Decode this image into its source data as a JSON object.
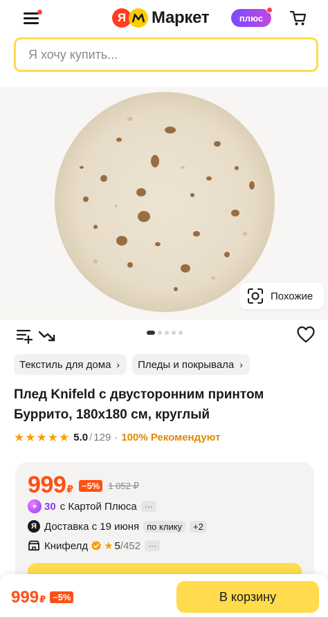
{
  "header": {
    "logo_letter": "Я",
    "logo_text": "Маркет",
    "plus_label": "плюс",
    "icons": [
      "menu-icon",
      "cart-icon"
    ]
  },
  "search": {
    "placeholder": "Я хочу купить..."
  },
  "gallery": {
    "similar_label": "Похожие",
    "total_images": 5,
    "active_index": 0
  },
  "breadcrumbs": [
    {
      "label": "Текстиль для дома"
    },
    {
      "label": "Пледы и покрывала"
    }
  ],
  "product": {
    "title": "Плед Knifeld с двусторонним принтом Буррито, 180х180 см, круглый",
    "rating": "5.0",
    "rating_separator": "/",
    "reviews_count": "129",
    "recommend_text": "100% Рекомендуют",
    "stars": 5
  },
  "price": {
    "current": "999",
    "currency": "₽",
    "discount": "−5%",
    "old_price": "1 052 ₽"
  },
  "plus_cashback": {
    "amount": "30",
    "text": "с Картой Плюса",
    "more": "···"
  },
  "delivery": {
    "text": "Доставка с 19 июня",
    "option": "по клику",
    "extra": "+2"
  },
  "seller": {
    "name": "Книфелд",
    "rating": "5",
    "rating_separator": "/",
    "reviews": "452",
    "more": "···"
  },
  "bottom_bar": {
    "price": "999",
    "currency": "₽",
    "discount": "−5%",
    "cta_label": "В корзину"
  },
  "colors": {
    "accent_yellow": "#ffdb4d",
    "price_orange": "#ff4f12",
    "star_orange": "#ff9b00",
    "plus_purple": "#8a3dff"
  }
}
